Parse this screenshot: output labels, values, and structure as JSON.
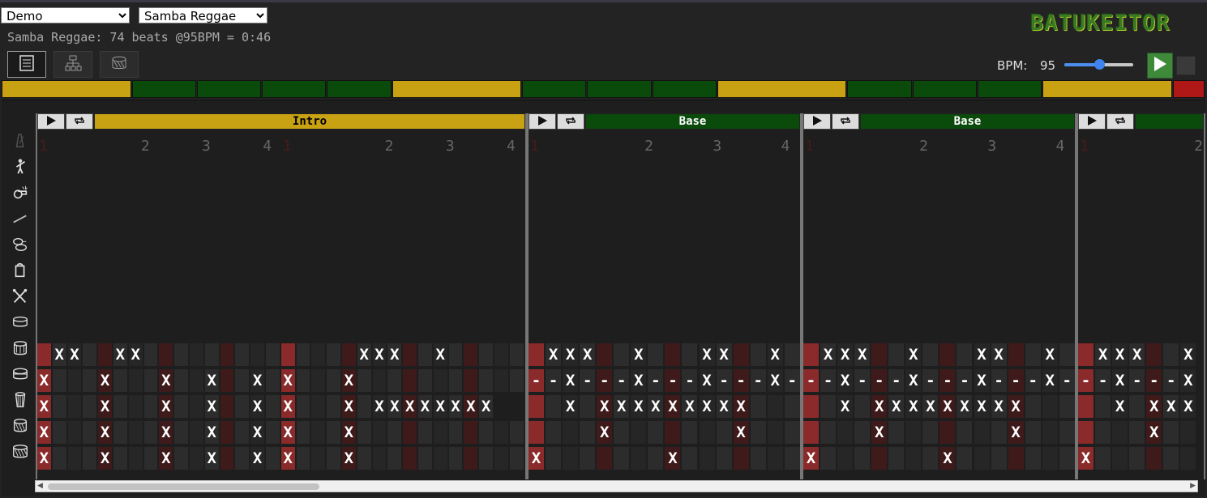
{
  "selectors": {
    "demo": "Demo",
    "rhythm": "Samba Reggae"
  },
  "info": "Samba Reggae: 74 beats @95BPM = 0:46",
  "logo": "BATUKEITOR",
  "views": [
    {
      "name": "score-view-button",
      "icon": "score-icon",
      "active": true
    },
    {
      "name": "structure-view-button",
      "icon": "tree-icon",
      "active": false
    },
    {
      "name": "instrument-view-button",
      "icon": "drum-icon",
      "active": false
    }
  ],
  "bpm": {
    "label": "BPM:",
    "value": "95",
    "fraction": 0.5
  },
  "colors": {
    "gold": "#c8a213",
    "green": "#0a4a0a",
    "red": "#b01818",
    "hit": "#8b2a2a"
  },
  "timeline": [
    {
      "type": "intro",
      "color": "#c8a213",
      "span": 2
    },
    {
      "type": "base",
      "color": "#0a4a0a",
      "span": 1
    },
    {
      "type": "base",
      "color": "#0a4a0a",
      "span": 1
    },
    {
      "type": "base",
      "color": "#0a4a0a",
      "span": 1
    },
    {
      "type": "base",
      "color": "#0a4a0a",
      "span": 1
    },
    {
      "type": "intro",
      "color": "#c8a213",
      "span": 2
    },
    {
      "type": "base",
      "color": "#0a4a0a",
      "span": 1
    },
    {
      "type": "base",
      "color": "#0a4a0a",
      "span": 1
    },
    {
      "type": "base",
      "color": "#0a4a0a",
      "span": 1
    },
    {
      "type": "intro",
      "color": "#c8a213",
      "span": 2
    },
    {
      "type": "base",
      "color": "#0a4a0a",
      "span": 1
    },
    {
      "type": "base",
      "color": "#0a4a0a",
      "span": 1
    },
    {
      "type": "base",
      "color": "#0a4a0a",
      "span": 1
    },
    {
      "type": "intro",
      "color": "#c8a213",
      "span": 2
    },
    {
      "type": "end",
      "color": "#b01818",
      "span": 0.5
    }
  ],
  "instruments": [
    {
      "name": "metronome-icon",
      "label": ""
    },
    {
      "name": "mestre-icon",
      "label": ""
    },
    {
      "name": "whistle-icon",
      "label": ""
    },
    {
      "name": "stick-icon",
      "label": ""
    },
    {
      "name": "agogo-icon",
      "label": ""
    },
    {
      "name": "shaker-icon",
      "label": ""
    },
    {
      "name": "crossed-sticks-icon",
      "label": ""
    },
    {
      "name": "snare-icon",
      "label": ""
    },
    {
      "name": "repique-icon",
      "label": ""
    },
    {
      "name": "caixa-icon",
      "label": ""
    },
    {
      "name": "timbal-icon",
      "label": ""
    },
    {
      "name": "surdo-2-icon",
      "label": ""
    },
    {
      "name": "surdo-1-icon",
      "label": ""
    }
  ],
  "blocks": [
    {
      "name": "Intro",
      "color": "#c8a213",
      "textColor": "#000000",
      "steps": 32,
      "beats": [
        "1",
        "2",
        "3",
        "4",
        "1",
        "2",
        "3",
        "4"
      ],
      "rows": [
        "_XX__XX______________XXX__X_____",
        "X___X___X__X__X_X___X___________",
        "X___X___X__X__X_X___X_XXXXXXXX",
        "X___X___X__X__X_X___X___________",
        "X___X___X__X__X_X___X___________"
      ]
    },
    {
      "name": "Base",
      "color": "#0a4a0a",
      "textColor": "#ffffff",
      "steps": 16,
      "beats": [
        "1",
        "2",
        "3",
        "4"
      ],
      "rows": [
        "_XXX__X___XX__X_",
        "--X---X---X---X-",
        "__X_XXXXXXXXX___",
        "____X_______X___",
        "X_______X_______"
      ]
    },
    {
      "name": "Base",
      "color": "#0a4a0a",
      "textColor": "#ffffff",
      "steps": 16,
      "beats": [
        "1",
        "2",
        "3",
        "4"
      ],
      "rows": [
        "_XXX__X___XX__X_",
        "--X---X---X---X-",
        "__X_XXXXXXXXX___",
        "____X_______X___",
        "X_______X_______"
      ]
    },
    {
      "name": "",
      "color": "#0a4a0a",
      "textColor": "#ffffff",
      "steps": 7,
      "beats": [
        "1",
        "2"
      ],
      "rows": [
        "_XXX__X",
        "--X---X",
        "__X_XXX",
        "____X__",
        "X______"
      ]
    }
  ]
}
